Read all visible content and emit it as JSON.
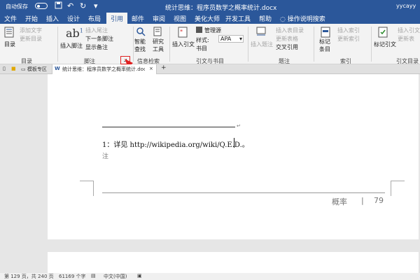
{
  "titlebar": {
    "autosave_label": "自动保存",
    "autosave_state": "关",
    "document_title": "统计思维：程序员数学之概率统计.docx",
    "user": "yycayy"
  },
  "menu": {
    "tabs": [
      "文件",
      "开始",
      "插入",
      "设计",
      "布局",
      "引用",
      "邮件",
      "审阅",
      "视图",
      "美化大师",
      "开发工具",
      "帮助"
    ],
    "active_tab": "引用",
    "search_placeholder": "操作说明搜索"
  },
  "ribbon": {
    "toc": {
      "label": "目录",
      "add_text": "添加文字",
      "update_toc": "更新目录",
      "group": "目录"
    },
    "footnotes": {
      "insert_footnote": "插入脚注",
      "insert_endnote": "插入尾注",
      "next_footnote": "下一条脚注",
      "show_notes": "显示备注",
      "group": "脚注"
    },
    "research": {
      "smart_lookup": "智能\n查找",
      "researcher": "研究\n工具",
      "group": "信息检索"
    },
    "citations": {
      "insert_citation": "插入引文",
      "manage_sources": "管理源",
      "style_label": "样式:",
      "style_value": "APA",
      "bibliography": "书目",
      "group": "引文与书目"
    },
    "captions": {
      "insert_caption": "插入题注",
      "insert_table_of_figures": "插入表目录",
      "update_table": "更新表格",
      "cross_reference": "交叉引用",
      "group": "题注"
    },
    "index": {
      "mark_entry": "标记\n条目",
      "insert_index": "插入索引",
      "update_index": "更新索引",
      "group": "索引"
    },
    "authorities": {
      "mark_citation": "标记引文",
      "insert_table": "插入引文",
      "update_table": "更新表",
      "group": "引文目录"
    }
  },
  "file_tabs": {
    "template_zone": "模板专区",
    "doc_tab": "统计思维：程序员数学之概率统计.docx"
  },
  "document": {
    "footnote_text": "1：详见 http://wikipedia.org/wiki/Q.E.D.。",
    "note_label": "注",
    "footer_section": "概率",
    "footer_sep": "|",
    "page_number": "79"
  },
  "statusbar": {
    "page_info": "第 129 页，共 240 页",
    "word_count": "61169 个字",
    "language": "中文(中国)"
  },
  "colors": {
    "accent": "#2b579a",
    "highlight": "#e02020"
  }
}
